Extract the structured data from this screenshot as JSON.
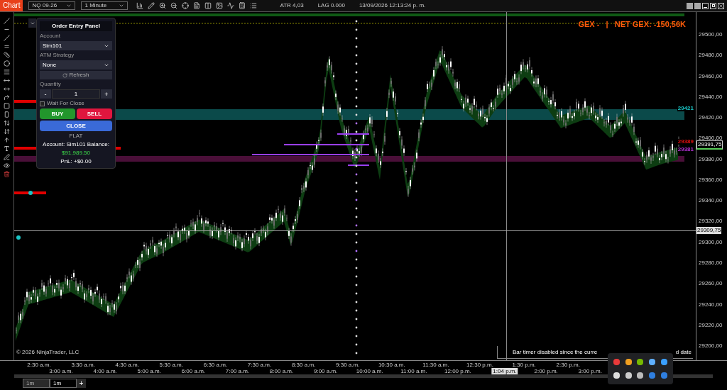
{
  "toolbar": {
    "tab": "Chart",
    "instrument": "NQ 09-26",
    "interval": "1 Minute",
    "atr": "ATR 4,03",
    "lag": "LAG 0.000",
    "datetime": "13/09/2026 12:13:24 p. m."
  },
  "order_panel": {
    "title": "Order Entry Panel",
    "account_label": "Account",
    "account": "Sim101",
    "atm_label": "ATM Strategy",
    "atm": "None",
    "refresh": "Refresh",
    "quantity_label": "Quantity",
    "minus": "-",
    "quantity": "1",
    "plus": "+",
    "wait_for_close": {
      "label": "Wait For Close",
      "checked": false
    },
    "buy": "BUY",
    "sell": "SELL",
    "close": "CLOSE",
    "position": "FLAT",
    "account_line": "Account: Sim101  Balance:",
    "balance": "$91,989.50",
    "pnl": "PnL: +$0.00"
  },
  "chart": {
    "gex": "GEX -   |   NET GEX: -150,56K",
    "level_labels": [
      {
        "text": "29421",
        "color": "#19c4c4"
      },
      {
        "text": "29389",
        "color": "#e01010"
      },
      {
        "text": "29381",
        "color": "#b030d0"
      }
    ],
    "price_ticks": [
      "29500,00",
      "29480,00",
      "29460,00",
      "29440,00",
      "29420,00",
      "29400,00",
      "29380,00",
      "29360,00",
      "29340,00",
      "29320,00",
      "29300,00",
      "29280,00",
      "29260,00",
      "29240,00",
      "29220,00",
      "29200,00"
    ],
    "price_markers": [
      {
        "text": "29391,75",
        "kind": "last"
      },
      {
        "text": "29309,75",
        "kind": "crosshair"
      }
    ],
    "time_ticks": [
      {
        "label": "2:30 a.m.",
        "kind": "tick"
      },
      {
        "label": "3:00 a.m.",
        "kind": "tick"
      },
      {
        "label": "3:30 a.m.",
        "kind": "tick"
      },
      {
        "label": "4:00 a.m.",
        "kind": "tick"
      },
      {
        "label": "4:30 a.m.",
        "kind": "tick"
      },
      {
        "label": "5:00 a.m.",
        "kind": "tick"
      },
      {
        "label": "5:30 a.m.",
        "kind": "tick"
      },
      {
        "label": "6:00 a.m.",
        "kind": "tick"
      },
      {
        "label": "6:30 a.m.",
        "kind": "tick"
      },
      {
        "label": "7:00 a.m.",
        "kind": "tick"
      },
      {
        "label": "7:30 a.m.",
        "kind": "tick"
      },
      {
        "label": "8:00 a.m.",
        "kind": "tick"
      },
      {
        "label": "8:30 a.m.",
        "kind": "tick"
      },
      {
        "label": "9:00 a.m.",
        "kind": "tick"
      },
      {
        "label": "9:30 a.m.",
        "kind": "tick"
      },
      {
        "label": "10:00 a.m.",
        "kind": "tick"
      },
      {
        "label": "10:30 a.m.",
        "kind": "tick"
      },
      {
        "label": "11:00 a.m.",
        "kind": "tick"
      },
      {
        "label": "11:30 a.m.",
        "kind": "tick"
      },
      {
        "label": "12:00 p.m.",
        "kind": "tick"
      },
      {
        "label": "12:30 p.m.",
        "kind": "tick"
      },
      {
        "label": "1:04 p.m.",
        "kind": "crosshair"
      },
      {
        "label": "1:30 p.m.",
        "kind": "tick"
      },
      {
        "label": "2:00 p.m.",
        "kind": "tick"
      },
      {
        "label": "2:30 p.m.",
        "kind": "tick"
      },
      {
        "label": "3:00 p.m.",
        "kind": "tick"
      }
    ],
    "copyright": "© 2026 NinjaTrader, LLC",
    "bar_timer": [
      "Bar timer disabled since the curre",
      "d date"
    ]
  },
  "tabs": [
    {
      "label": "1m",
      "selected": false
    },
    {
      "label": "1m",
      "selected": true
    }
  ],
  "add_tab": "+"
}
